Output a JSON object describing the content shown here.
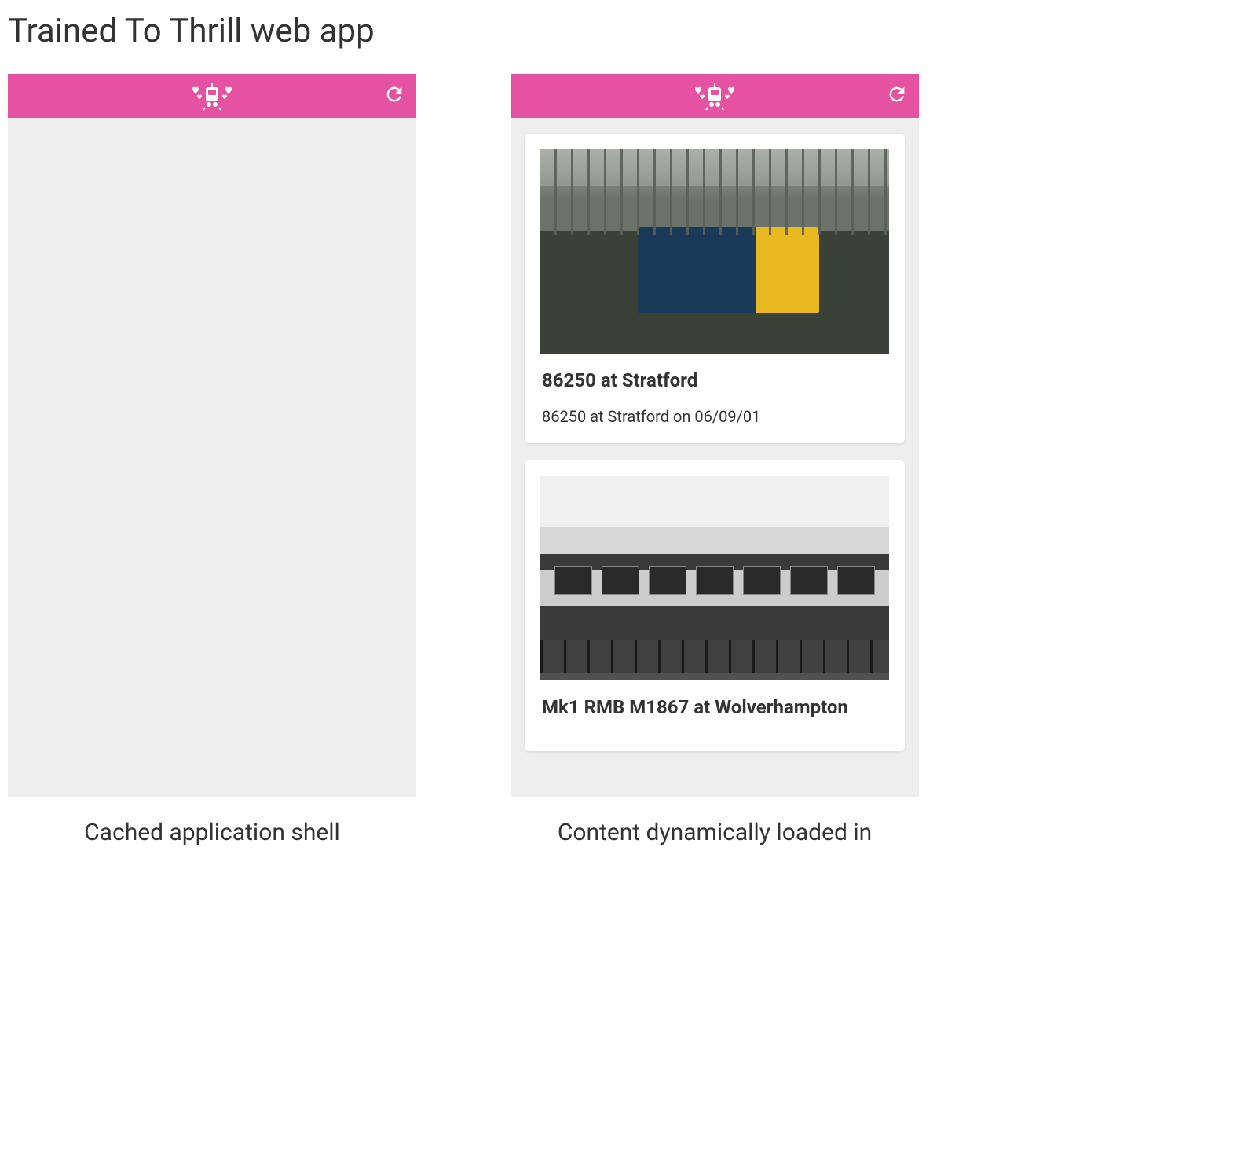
{
  "page": {
    "title": "Trained To Thrill web app"
  },
  "colors": {
    "header_bg": "#e452a1"
  },
  "panels": {
    "left": {
      "caption": "Cached application shell"
    },
    "right": {
      "caption": "Content dynamically loaded in",
      "cards": [
        {
          "title": "86250 at Stratford",
          "description": "86250 at Stratford on 06/09/01"
        },
        {
          "title": "Mk1 RMB M1867 at Wolverhampton",
          "description": ""
        }
      ]
    }
  },
  "icons": {
    "logo": "train-hearts-icon",
    "refresh": "refresh-icon"
  }
}
